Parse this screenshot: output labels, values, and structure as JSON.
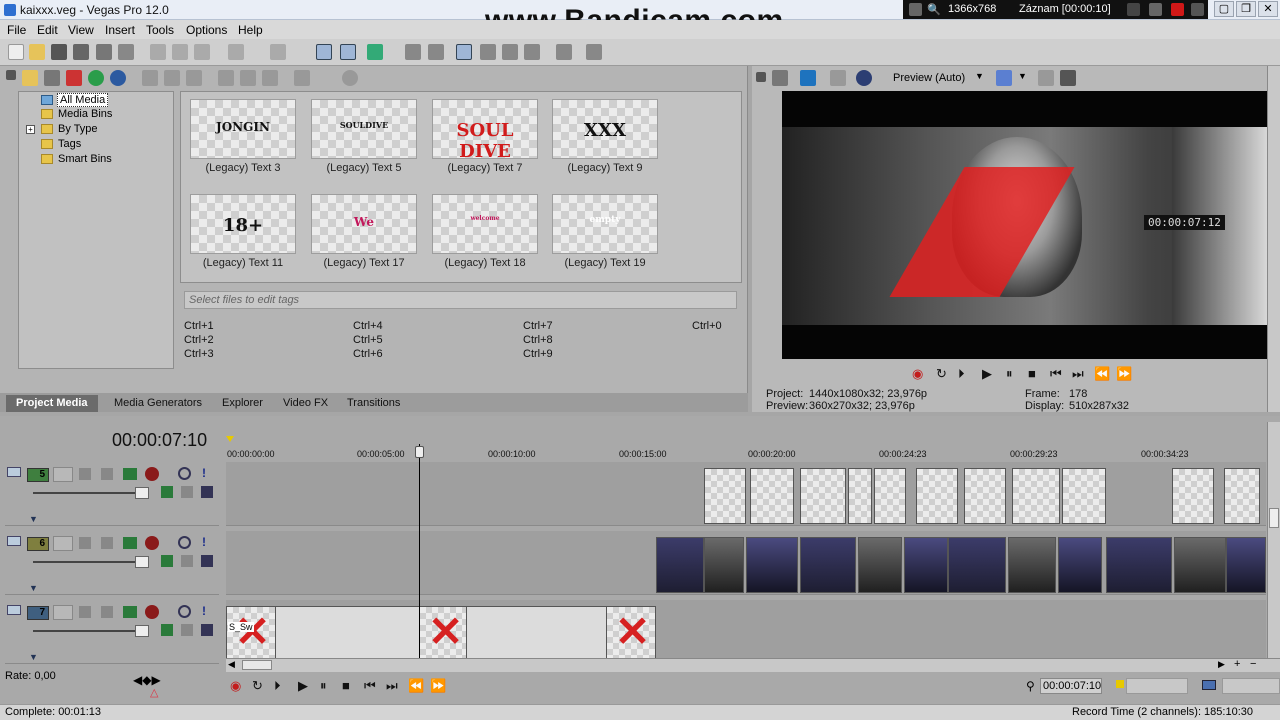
{
  "app": {
    "title": "kaixxx.veg - Vegas Pro 12.0"
  },
  "watermark": "www.Bandicam.com",
  "recorder": {
    "resolution": "1366x768",
    "status": "Záznam [00:00:10]"
  },
  "menu": [
    "File",
    "Edit",
    "View",
    "Insert",
    "Tools",
    "Options",
    "Help"
  ],
  "media_tree": [
    "All Media",
    "Media Bins",
    "By Type",
    "Tags",
    "Smart Bins"
  ],
  "media_thumbs": [
    {
      "caption": "(Legacy) Text 3",
      "text": "JONGIN",
      "color": "#111111"
    },
    {
      "caption": "(Legacy) Text 5",
      "text": "SOULDIVE",
      "color": "#111111"
    },
    {
      "caption": "(Legacy) Text 7",
      "text": "SOUL DIVE",
      "color": "#d11b1b"
    },
    {
      "caption": "(Legacy) Text 9",
      "text": "XXX",
      "color": "#111111"
    },
    {
      "caption": "(Legacy) Text 11",
      "text": "18+",
      "color": "#111111"
    },
    {
      "caption": "(Legacy) Text 17",
      "text": "We",
      "color": "#c2185b"
    },
    {
      "caption": "(Legacy) Text 18",
      "text": "welcome",
      "color": "#c2185b"
    },
    {
      "caption": "(Legacy) Text 19",
      "text": "empty",
      "color": "#ffffff"
    }
  ],
  "tags_placeholder": "Select files to edit tags",
  "shortcuts": [
    "Ctrl+1",
    "Ctrl+2",
    "Ctrl+3",
    "Ctrl+4",
    "Ctrl+5",
    "Ctrl+6",
    "Ctrl+7",
    "Ctrl+8",
    "Ctrl+9",
    "Ctrl+0"
  ],
  "tabs": [
    "Project Media",
    "Media Generators",
    "Explorer",
    "Video FX",
    "Transitions"
  ],
  "preview": {
    "mode": "Preview (Auto)",
    "timecode_overlay": "00:00:07:12",
    "project_label": "Project:",
    "project_value": "1440x1080x32; 23,976p",
    "preview_label": "Preview:",
    "preview_value": "360x270x32; 23,976p",
    "frame_label": "Frame:",
    "frame_value": "178",
    "display_label": "Display:",
    "display_value": "510x287x32"
  },
  "timeline": {
    "timecode": "00:00:07:10",
    "ruler": [
      "00:00:00:00",
      "00:00:05:00",
      "00:00:10:00",
      "00:00:15:00",
      "00:00:20:00",
      "00:00:24:23",
      "00:00:29:23",
      "00:00:34:23"
    ],
    "tracks": [
      {
        "number": "5",
        "color": "#3f7f3f"
      },
      {
        "number": "6",
        "color": "#7f7f3f"
      },
      {
        "number": "7",
        "color": "#3f5f7f"
      }
    ],
    "clip_label": "S_Sw"
  },
  "rate_label": "Rate: 0,00",
  "transport_time": "00:00:07:10",
  "status": {
    "complete": "Complete: 00:01:13",
    "record_time": "Record Time (2 channels): 185:10:30"
  }
}
